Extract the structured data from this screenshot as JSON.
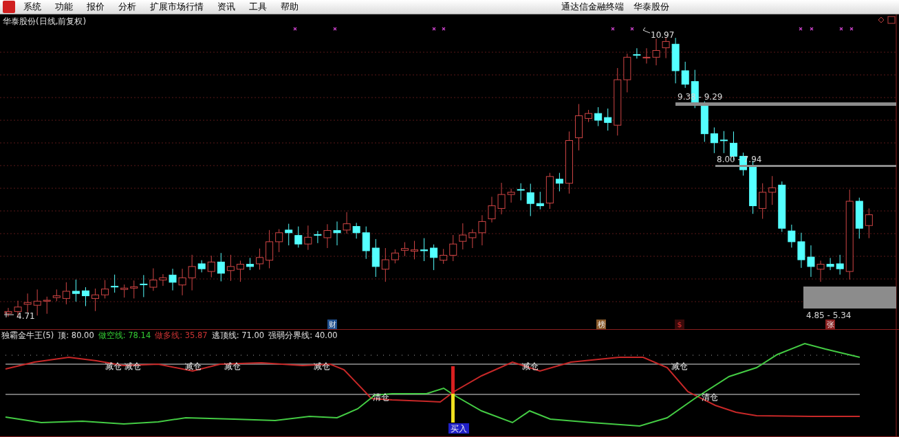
{
  "menu_bar": {
    "items": [
      "系统",
      "功能",
      "报价",
      "分析",
      "扩展市场行情",
      "资讯",
      "工具",
      "帮助"
    ],
    "app_title": "通达信金融终端",
    "broker": "华泰股份"
  },
  "price_chart": {
    "title": "华泰股份(日线,前复权)",
    "labels": [
      {
        "kind": "high",
        "text": "10.97"
      },
      {
        "kind": "range",
        "text": "9.38 - 9.29"
      },
      {
        "kind": "range",
        "text": "8.00 - 7.94"
      },
      {
        "kind": "low",
        "text": "4.71"
      },
      {
        "kind": "range",
        "text": "4.85 - 5.34"
      }
    ],
    "events": [
      {
        "text": "财",
        "color": "#1f4f8f"
      },
      {
        "text": "榜",
        "color": "#8a5a2a"
      },
      {
        "text": "$",
        "color": "#3a0a0a"
      },
      {
        "text": "张",
        "color": "#8a1f1f"
      }
    ]
  },
  "indicator": {
    "name": "独霸金牛王(5)",
    "legend": [
      {
        "label": "顶:",
        "value": "80.00",
        "color": "#e0e0e0"
      },
      {
        "label": "做空线:",
        "value": "78.14",
        "color": "#33cc33"
      },
      {
        "label": "做多线:",
        "value": "35.87",
        "color": "#cc3333"
      },
      {
        "label": "逃顶线:",
        "value": "71.00",
        "color": "#e0e0e0"
      },
      {
        "label": "强弱分界线:",
        "value": "40.00",
        "color": "#e0e0e0"
      }
    ],
    "signals": [
      {
        "text": "减仓"
      },
      {
        "text": "减仓"
      },
      {
        "text": "减仓"
      },
      {
        "text": "减仓"
      },
      {
        "text": "减仓"
      },
      {
        "text": "减仓"
      },
      {
        "text": "减仓"
      },
      {
        "text": "清仓"
      },
      {
        "text": "清仓"
      }
    ],
    "buy": "买入"
  }
}
